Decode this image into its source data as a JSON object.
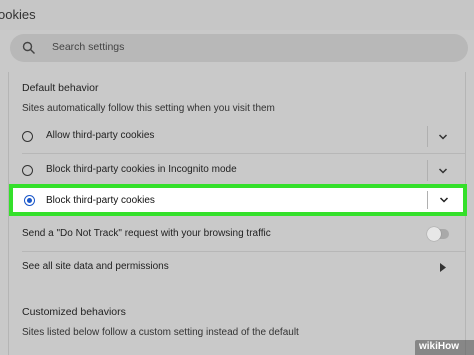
{
  "header": {
    "title": "ookies"
  },
  "search": {
    "placeholder": "Search settings",
    "icon": "search-icon"
  },
  "default_behavior": {
    "title": "Default behavior",
    "subtitle": "Sites automatically follow this setting when you visit them",
    "options": [
      {
        "label": "Allow third-party cookies",
        "selected": false
      },
      {
        "label": "Block third-party cookies in Incognito mode",
        "selected": false
      },
      {
        "label": "Block third-party cookies",
        "selected": true
      }
    ]
  },
  "do_not_track": {
    "label": "Send a \"Do Not Track\" request with your browsing traffic",
    "enabled": false
  },
  "site_data": {
    "label": "See all site data and permissions"
  },
  "customized": {
    "title": "Customized behaviors",
    "subtitle": "Sites listed below follow a custom setting instead of the default"
  },
  "colors": {
    "accent": "#1a57c9",
    "highlight_border": "#34e02a",
    "background": "#c9c9c9"
  },
  "watermark": "wikiHow"
}
